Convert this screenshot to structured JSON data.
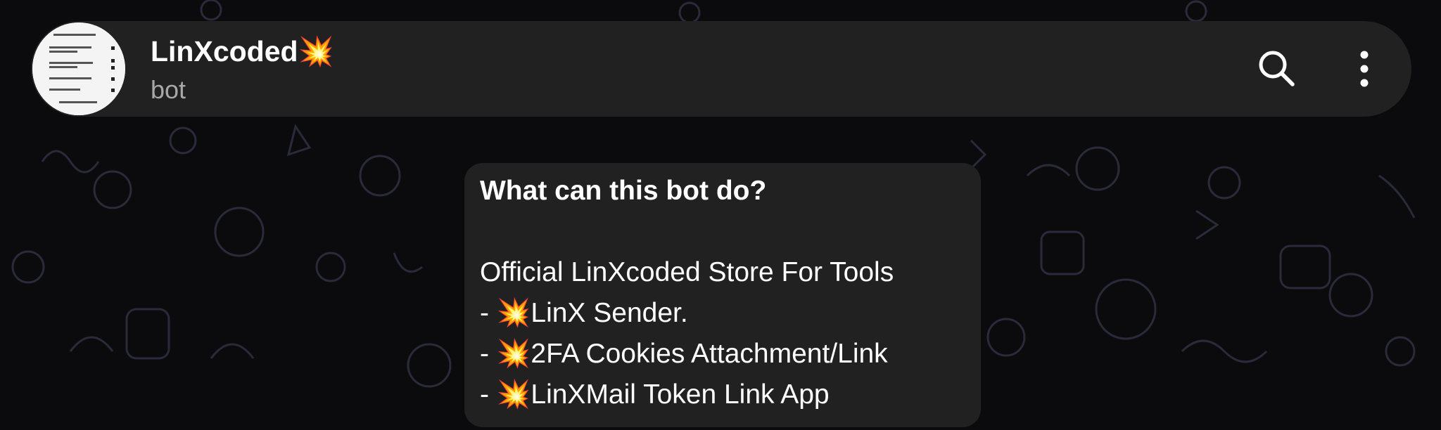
{
  "chat_header": {
    "title": "LinXcoded💥",
    "subtitle": "bot",
    "avatar_icon": "bot-profile-document-icon",
    "search_icon": "search-icon",
    "more_icon": "more-vertical-icon"
  },
  "intro_message": {
    "heading": "What can this bot do?",
    "lines": [
      "Official LinXcoded Store For Tools",
      "- 💥LinX Sender.",
      "- 💥2FA Cookies Attachment/Link",
      "- 💥LinXMail Token Link App"
    ]
  },
  "colors": {
    "background": "#0b0b0d",
    "header_bg": "#212121",
    "bubble_bg": "#212121",
    "text_primary": "#ffffff",
    "text_secondary": "#a8a8a8"
  }
}
